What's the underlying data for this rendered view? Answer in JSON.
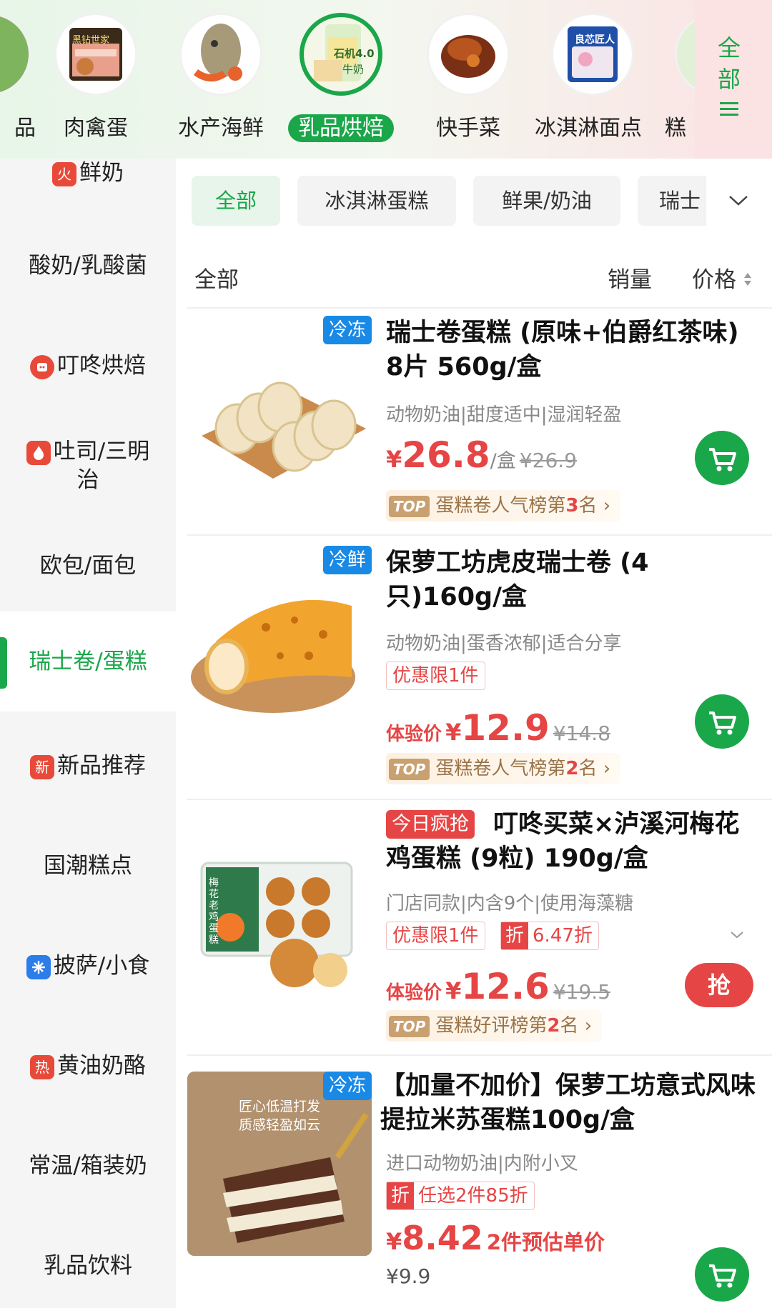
{
  "categories": [
    {
      "label": "品",
      "name": "cat-partial-left"
    },
    {
      "label": "肉禽蛋",
      "name": "cat-meat-egg"
    },
    {
      "label": "水产海鲜",
      "name": "cat-seafood"
    },
    {
      "label": "乳品烘焙",
      "name": "cat-dairy-bakery"
    },
    {
      "label": "快手菜",
      "name": "cat-quick-dish"
    },
    {
      "label": "冰淇淋面点",
      "name": "cat-icecream"
    },
    {
      "label": "糕",
      "name": "cat-partial-right"
    }
  ],
  "category_images": {
    "meat": "黑钻世家",
    "dairy": "石机4.0",
    "dairy2": "牛奶",
    "icecream": "良芯匠人"
  },
  "more": {
    "line1": "全",
    "line2": "部"
  },
  "sidebar": {
    "items": [
      {
        "label": "鲜奶",
        "badge": "火"
      },
      {
        "label": "酸奶/乳酸菌"
      },
      {
        "label": "叮咚烘焙"
      },
      {
        "label": "吐司/三明",
        "label2": "治"
      },
      {
        "label": "欧包/面包"
      },
      {
        "label": "瑞士卷/蛋糕"
      },
      {
        "label": "新品推荐",
        "badge": "新"
      },
      {
        "label": "国潮糕点"
      },
      {
        "label": "披萨/小食"
      },
      {
        "label": "黄油奶酪",
        "badge": "热"
      },
      {
        "label": "常温/箱装奶"
      },
      {
        "label": "乳品饮料"
      }
    ]
  },
  "chips": [
    "全部",
    "冰淇淋蛋糕",
    "鲜果/奶油",
    "瑞士"
  ],
  "sort": {
    "all": "全部",
    "sales": "销量",
    "price": "价格"
  },
  "products": [
    {
      "tag": "冷冻",
      "title": "瑞士卷蛋糕 (原味+伯爵红茶味) 8片 560g/盒",
      "sub": "动物奶油|甜度适中|湿润轻盈",
      "price": "26.8",
      "unit": "/盒",
      "orig": "¥26.9",
      "rank_pre": "蛋糕卷人气榜第",
      "rank_num": "3",
      "rank_post": "名"
    },
    {
      "tag": "冷鲜",
      "title": "保萝工坊虎皮瑞士卷 (4只)160g/盒",
      "sub": "动物奶油|蛋香浓郁|适合分享",
      "promo": "优惠限1件",
      "price_prefix": "体验价",
      "price": "12.9",
      "orig": "¥14.8",
      "rank_pre": "蛋糕卷人气榜第",
      "rank_num": "2",
      "rank_post": "名"
    },
    {
      "tag": "今日疯抢",
      "title": "叮咚买菜×泸溪河梅花鸡蛋糕 (9粒) 190g/盒",
      "sub": "门店同款|内含9个|使用海藻糖",
      "promo": "优惠限1件",
      "promo2_icon": "折",
      "promo2": "6.47折",
      "price_prefix": "体验价",
      "price": "12.6",
      "orig": "¥19.5",
      "btn": "抢",
      "rank_pre": "蛋糕好评榜第",
      "rank_num": "2",
      "rank_post": "名",
      "img_text": "梅花老鸡蛋糕"
    },
    {
      "tag": "冷冻",
      "title": "【加量不加价】保萝工坊意式风味提拉米苏蛋糕100g/盒",
      "sub": "进口动物奶油|内附小叉",
      "promo_icon": "折",
      "promo": "任选2件85折",
      "price": "8.42",
      "price_note": "2件预估单价",
      "orig": "¥9.9",
      "img_text1": "匠心低温打发",
      "img_text2": "质感轻盈如云"
    }
  ],
  "currency": "¥",
  "top_label": "TOP",
  "colors": {
    "accent": "#1aa74a",
    "price": "#e64545",
    "tag": "#1989e6"
  }
}
